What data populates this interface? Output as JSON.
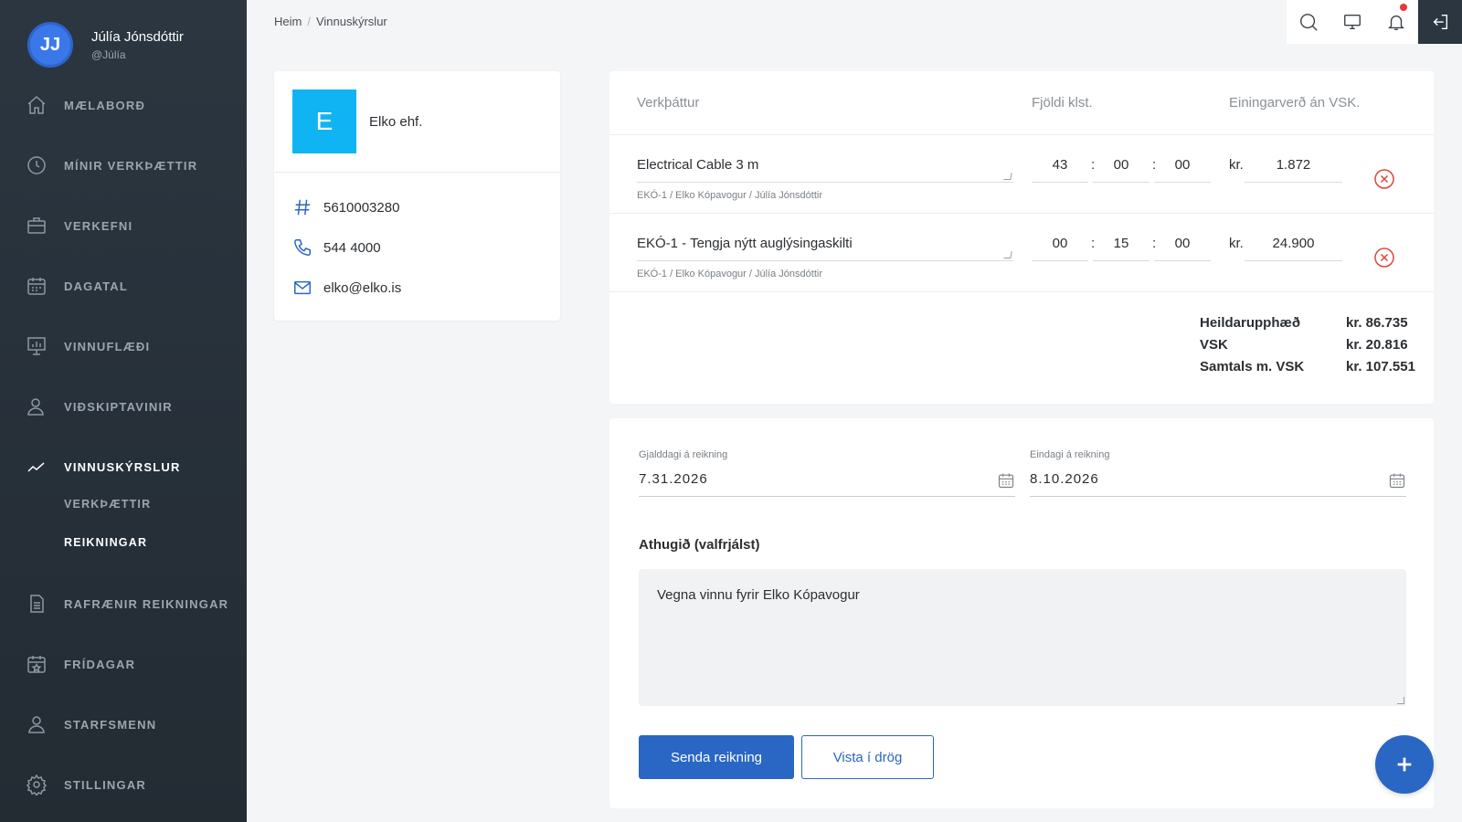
{
  "user": {
    "initials": "JJ",
    "name": "Júlía Jónsdóttir",
    "handle": "@Júlía"
  },
  "sidebar": {
    "items": [
      {
        "label": "MÆLABORÐ",
        "icon": "home-icon"
      },
      {
        "label": "MÍNIR VERKÞÆTTIR",
        "icon": "clock-icon"
      },
      {
        "label": "VERKEFNI",
        "icon": "briefcase-icon"
      },
      {
        "label": "DAGATAL",
        "icon": "calendar-icon"
      },
      {
        "label": "VINNUFLÆÐI",
        "icon": "presentation-board-icon"
      },
      {
        "label": "VIÐSKIPTAVINIR",
        "icon": "user-icon"
      },
      {
        "label": "VINNUSKÝRSLUR",
        "icon": "trend-line-icon",
        "active": true
      },
      {
        "label": "RAFRÆNIR REIKNINGAR",
        "icon": "document-icon"
      },
      {
        "label": "FRÍDAGAR",
        "icon": "calendar-star-icon"
      },
      {
        "label": "STARFSMENN",
        "icon": "users-icon"
      },
      {
        "label": "STILLINGAR",
        "icon": "gear-icon"
      }
    ],
    "subitems": [
      {
        "label": "VERKÞÆTTIR"
      },
      {
        "label": "REIKNINGAR",
        "active": true
      }
    ]
  },
  "breadcrumb": {
    "home": "Heim",
    "current": "Vinnuskýrslur"
  },
  "customer": {
    "logo_letter": "E",
    "name": "Elko ehf.",
    "kennitala": "5610003280",
    "phone": "544 4000",
    "email": "elko@elko.is"
  },
  "lines": {
    "headers": {
      "task": "Verkþáttur",
      "hours": "Fjöldi klst.",
      "unit_price": "Einingarverð án VSK."
    },
    "rows": [
      {
        "desc": "Electrical Cable 3 m",
        "sub": "EKÓ-1 / Elko Kópavogur / Júlía Jónsdóttir",
        "h": "43",
        "m": "00",
        "s": "00",
        "currency": "kr.",
        "price": "1.872"
      },
      {
        "desc": "EKÓ-1 - Tengja nýtt auglýsingaskilti",
        "sub": "EKÓ-1 / Elko Kópavogur / Júlía Jónsdóttir",
        "h": "00",
        "m": "15",
        "s": "00",
        "currency": "kr.",
        "price": "24.900"
      }
    ],
    "colon": ":",
    "totals": [
      {
        "label": "Heildarupphæð",
        "value": "kr. 86.735"
      },
      {
        "label": "VSK",
        "value": "kr. 20.816"
      },
      {
        "label": "Samtals m. VSK",
        "value": "kr. 107.551"
      }
    ]
  },
  "form": {
    "due_label": "Gjalddagi á reikning",
    "due_value": "7.31.2026",
    "final_label": "Eindagi á reikning",
    "final_value": "8.10.2026",
    "note_label": "Athugið (valfrjálst)",
    "note_value": "Vegna vinnu fyrir Elko Kópavogur",
    "send_label": "Senda reikning",
    "draft_label": "Vista í drög"
  },
  "colors": {
    "primary": "#2a66c4",
    "sidebar": "#2b3640",
    "logo": "#10b4f3",
    "delete": "#e0453a"
  }
}
